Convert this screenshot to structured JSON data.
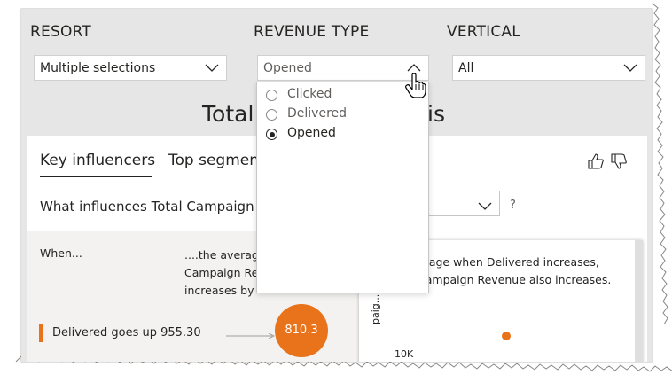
{
  "slicers": {
    "resort": {
      "title": "RESORT",
      "value": "Multiple selections"
    },
    "revenue_type": {
      "title": "REVENUE TYPE",
      "value": "Opened",
      "options": [
        {
          "label": "Clicked",
          "selected": false
        },
        {
          "label": "Delivered",
          "selected": false
        },
        {
          "label": "Opened",
          "selected": true
        }
      ]
    },
    "vertical": {
      "title": "VERTICAL",
      "value": "All"
    }
  },
  "report": {
    "title_left": "Total",
    "title_right": "is"
  },
  "visual": {
    "tabs": {
      "key_influencers": "Key influencers",
      "top_segments": "Top segmen"
    },
    "question": "What influences Total Campaign Re",
    "help": "?",
    "left": {
      "when": "When...",
      "average_line1": "....the average",
      "average_line2": "Campaign Re",
      "average_line3": "increases by",
      "influencer": "Delivered goes up 955.30",
      "bubble_value": "810.3"
    },
    "right": {
      "desc_line1": "erage when Delivered increases,",
      "desc_line2": "Campaign Revenue also increases.",
      "axis_label": "paig...",
      "tick": "10K"
    }
  },
  "colors": {
    "accent": "#e8731a",
    "canvas": "#e6e6e6"
  },
  "icons": [
    "chevron-down-icon",
    "chevron-up-icon",
    "thumbs-up-icon",
    "thumbs-down-icon",
    "hand-pointer-icon"
  ]
}
